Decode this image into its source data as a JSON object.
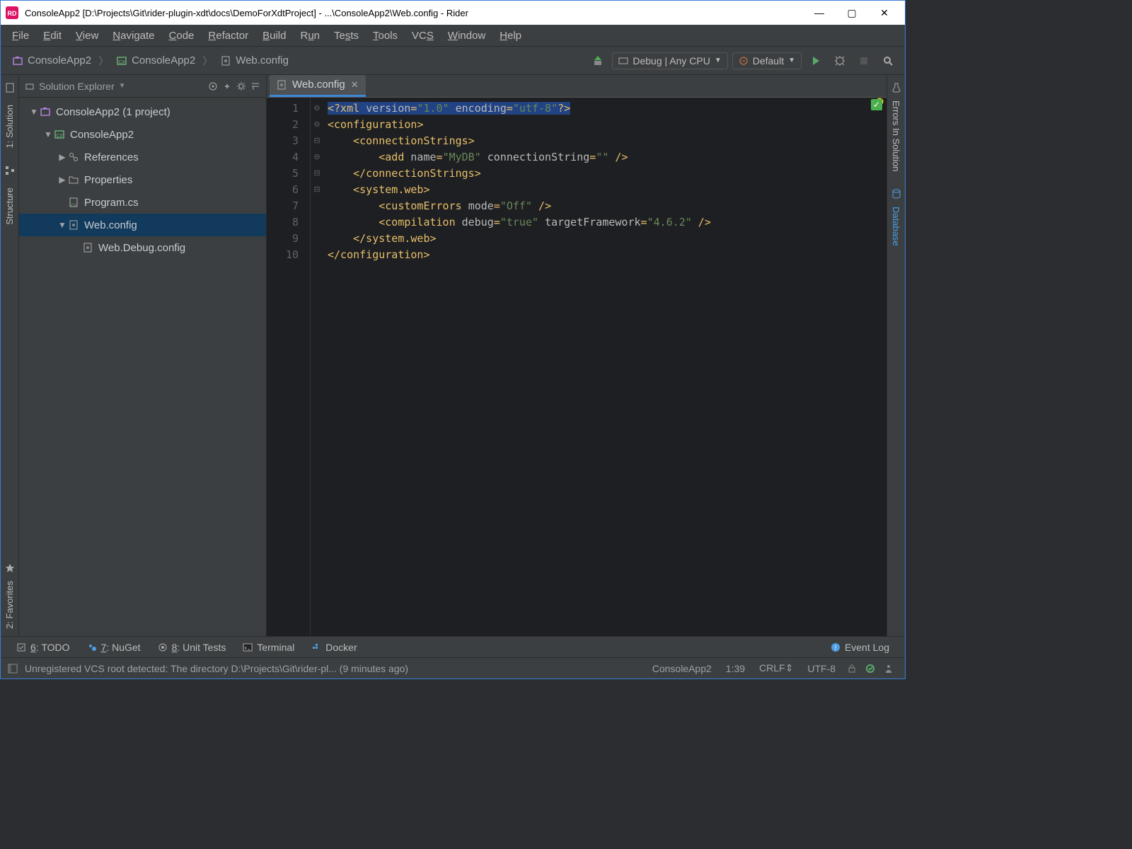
{
  "title": "ConsoleApp2 [D:\\Projects\\Git\\rider-plugin-xdt\\docs\\DemoForXdtProject] - ...\\ConsoleApp2\\Web.config - Rider",
  "menu": [
    "File",
    "Edit",
    "View",
    "Navigate",
    "Code",
    "Refactor",
    "Build",
    "Run",
    "Tests",
    "Tools",
    "VCS",
    "Window",
    "Help"
  ],
  "breadcrumbs": [
    "ConsoleApp2",
    "ConsoleApp2",
    "Web.config"
  ],
  "run_config": "Debug | Any CPU",
  "run_profile": "Default",
  "sidebar": {
    "header": "Solution Explorer",
    "tree": [
      {
        "depth": 0,
        "arrow": "▼",
        "icon": "sln",
        "label": "ConsoleApp2 (1 project)"
      },
      {
        "depth": 1,
        "arrow": "▼",
        "icon": "csproj",
        "label": "ConsoleApp2"
      },
      {
        "depth": 2,
        "arrow": "▶",
        "icon": "ref",
        "label": "References"
      },
      {
        "depth": 2,
        "arrow": "▶",
        "icon": "folder",
        "label": "Properties"
      },
      {
        "depth": 2,
        "arrow": " ",
        "icon": "cs",
        "label": "Program.cs"
      },
      {
        "depth": 2,
        "arrow": "▼",
        "icon": "cfg",
        "label": "Web.config",
        "selected": true
      },
      {
        "depth": 3,
        "arrow": " ",
        "icon": "cfg",
        "label": "Web.Debug.config"
      }
    ]
  },
  "left_tabs": [
    "1: Solution",
    "Structure",
    "2: Favorites"
  ],
  "right_tabs": [
    "Errors In Solution",
    "Database"
  ],
  "editor": {
    "tab_label": "Web.config",
    "lines": [
      1,
      2,
      3,
      4,
      5,
      6,
      7,
      8,
      9,
      10
    ],
    "code_tokens": [
      [
        "<",
        "?xml",
        " ",
        "version",
        "=",
        "\"1.0\"",
        " ",
        "encoding",
        "=",
        "\"utf-8\"",
        "?",
        ">"
      ],
      [
        "<",
        "configuration",
        ">"
      ],
      [
        "    ",
        "<",
        "connectionStrings",
        ">"
      ],
      [
        "        ",
        "<",
        "add",
        " ",
        "name",
        "=",
        "\"MyDB\"",
        " ",
        "connectionString",
        "=",
        "\"\"",
        " /",
        ">"
      ],
      [
        "    ",
        "<",
        "/connectionStrings",
        ">"
      ],
      [
        "    ",
        "<",
        "system.web",
        ">"
      ],
      [
        "        ",
        "<",
        "customErrors",
        " ",
        "mode",
        "=",
        "\"Off\"",
        " /",
        ">"
      ],
      [
        "        ",
        "<",
        "compilation",
        " ",
        "debug",
        "=",
        "\"true\"",
        " ",
        "targetFramework",
        "=",
        "\"4.6.2\"",
        " /",
        ">"
      ],
      [
        "    ",
        "<",
        "/system.web",
        ">"
      ],
      [
        "<",
        "/configuration",
        ">"
      ]
    ]
  },
  "bottom_tools": [
    {
      "icon": "todo",
      "label": "6: TODO"
    },
    {
      "icon": "nuget",
      "label": "7: NuGet"
    },
    {
      "icon": "tests",
      "label": "8: Unit Tests"
    },
    {
      "icon": "terminal",
      "label": "Terminal"
    },
    {
      "icon": "docker",
      "label": "Docker"
    }
  ],
  "event_log": "Event Log",
  "status": {
    "msg": "Unregistered VCS root detected: The directory D:\\Projects\\Git\\rider-pl... (9 minutes ago)",
    "context": "ConsoleApp2",
    "pos": "1:39",
    "eol": "CRLF",
    "enc": "UTF-8"
  }
}
